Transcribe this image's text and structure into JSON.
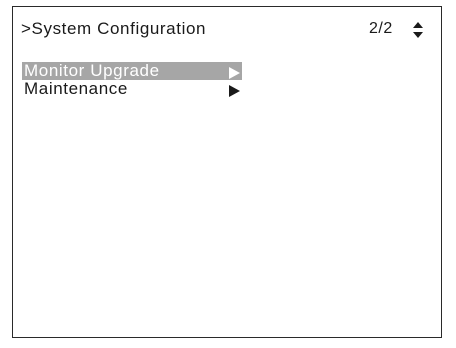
{
  "header": {
    "title": ">System Configuration",
    "page_indicator": "2/2",
    "scroll_icon": "up-down-arrows-icon"
  },
  "menu": {
    "items": [
      {
        "label": "Monitor Upgrade",
        "selected": true,
        "icon": "right-triangle-icon"
      },
      {
        "label": "Maintenance",
        "selected": false,
        "icon": "right-triangle-icon"
      }
    ]
  },
  "colors": {
    "background": "#ffffff",
    "text": "#1a1a1a",
    "highlight": "#a6a6a6",
    "highlight_text": "#ffffff",
    "border": "#2a2a2a"
  }
}
